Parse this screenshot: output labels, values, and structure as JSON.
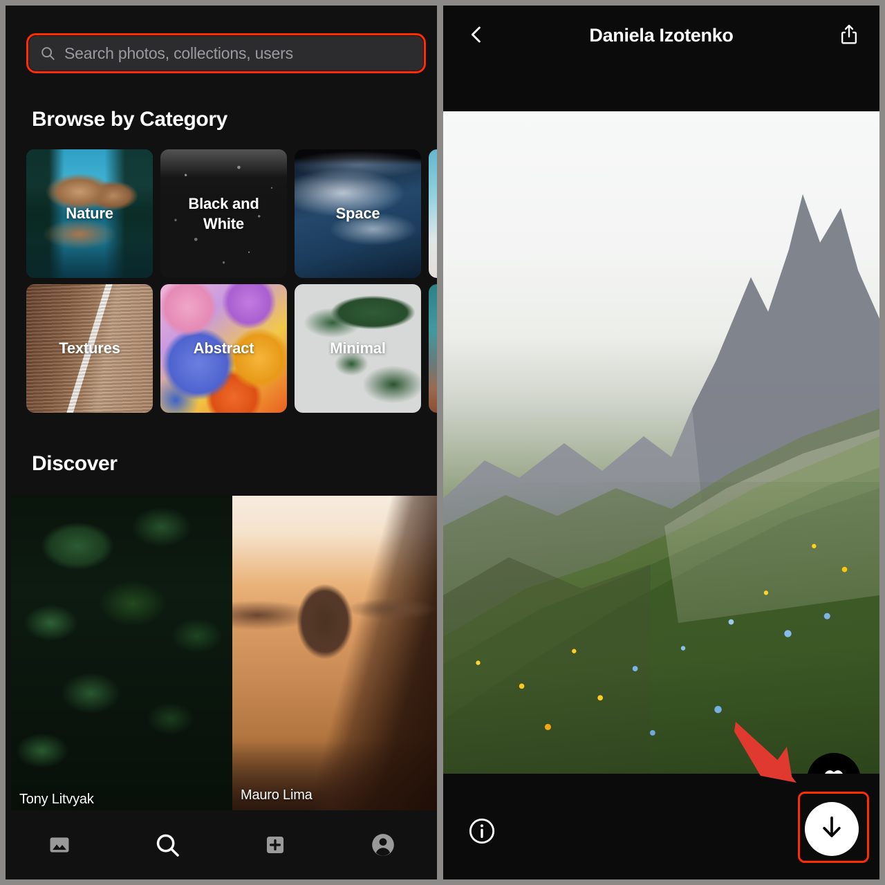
{
  "theme": {
    "bg": "#111111",
    "accent_highlight": "#ff2d00",
    "arrow": "#e03a30",
    "outer_border": "#8c8a88"
  },
  "left_screen": {
    "search": {
      "placeholder": "Search photos, collections, users",
      "value": "",
      "icon": "search-icon",
      "highlighted": true
    },
    "browse_section": {
      "title": "Browse by Category"
    },
    "categories": [
      {
        "label": "Nature",
        "art": "art-nature"
      },
      {
        "label": "Black and White",
        "art": "art-bw"
      },
      {
        "label": "Space",
        "art": "art-space"
      },
      {
        "label": "",
        "art": "art-pink"
      },
      {
        "label": "Textures",
        "art": "art-textures"
      },
      {
        "label": "Abstract",
        "art": "art-abstract"
      },
      {
        "label": "Minimal",
        "art": "art-minimal"
      },
      {
        "label": "",
        "art": "art-teal"
      }
    ],
    "discover_section": {
      "title": "Discover"
    },
    "discover_photos": [
      {
        "credit": "Tony Litvyak"
      },
      {
        "credit": "Mauro Lima"
      }
    ],
    "tabbar": [
      {
        "name": "photos-tab",
        "icon": "image-icon",
        "active": false
      },
      {
        "name": "search-tab",
        "icon": "search-icon",
        "active": true
      },
      {
        "name": "upload-tab",
        "icon": "plus-box-icon",
        "active": false
      },
      {
        "name": "profile-tab",
        "icon": "person-icon",
        "active": false
      }
    ]
  },
  "right_screen": {
    "nav": {
      "back_label": "chevron-left-icon",
      "title": "Daniela Izotenko",
      "share_label": "share-icon"
    },
    "actions": [
      {
        "name": "like-button",
        "icon": "heart-icon",
        "style": "dark"
      },
      {
        "name": "add-button",
        "icon": "plus-icon",
        "style": "dark"
      },
      {
        "name": "download-button",
        "icon": "arrow-down-icon",
        "style": "light",
        "highlighted": true
      }
    ],
    "info_button": {
      "icon": "info-icon"
    }
  }
}
